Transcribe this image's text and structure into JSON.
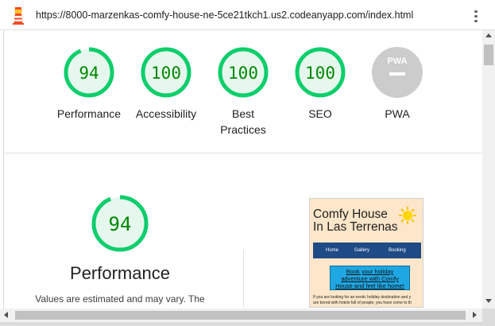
{
  "urlbar": {
    "url": "https://8000-marzenkas-comfy-house-ne-5ce21tkch1.us2.codeanyapp.com/index.html",
    "logo_icon": "lighthouse-icon",
    "menu_icon": "more-vert-icon"
  },
  "scores": [
    {
      "label": "Performance",
      "value": "94",
      "score": 94
    },
    {
      "label": "Accessibility",
      "value": "100",
      "score": 100
    },
    {
      "label": "Best",
      "label2": "Practices",
      "value": "100",
      "score": 100
    },
    {
      "label": "SEO",
      "value": "100",
      "score": 100
    },
    {
      "label": "PWA",
      "badge": "PWA"
    }
  ],
  "colors": {
    "pass": "#0cce6b",
    "pass_fill": "#e6f8ee",
    "pass_text": "#008800",
    "pwa": "#cccccc"
  },
  "detail": {
    "score": "94",
    "title": "Performance",
    "note": "Values are estimated and may vary. The"
  },
  "thumbnail": {
    "title_line1": "Comfy House",
    "title_line2": "In Las Terrenas",
    "nav": [
      "Home",
      "Gallery",
      "Booking"
    ],
    "cta_line1": "Book your holiday",
    "cta_line2": "adventure with Comfy",
    "cta_line3": "House and feel like home!",
    "para_line1": "If you are looking for an exotic holiday destination and y",
    "para_line2": "are bored with hotels full of people, you have come to th"
  }
}
